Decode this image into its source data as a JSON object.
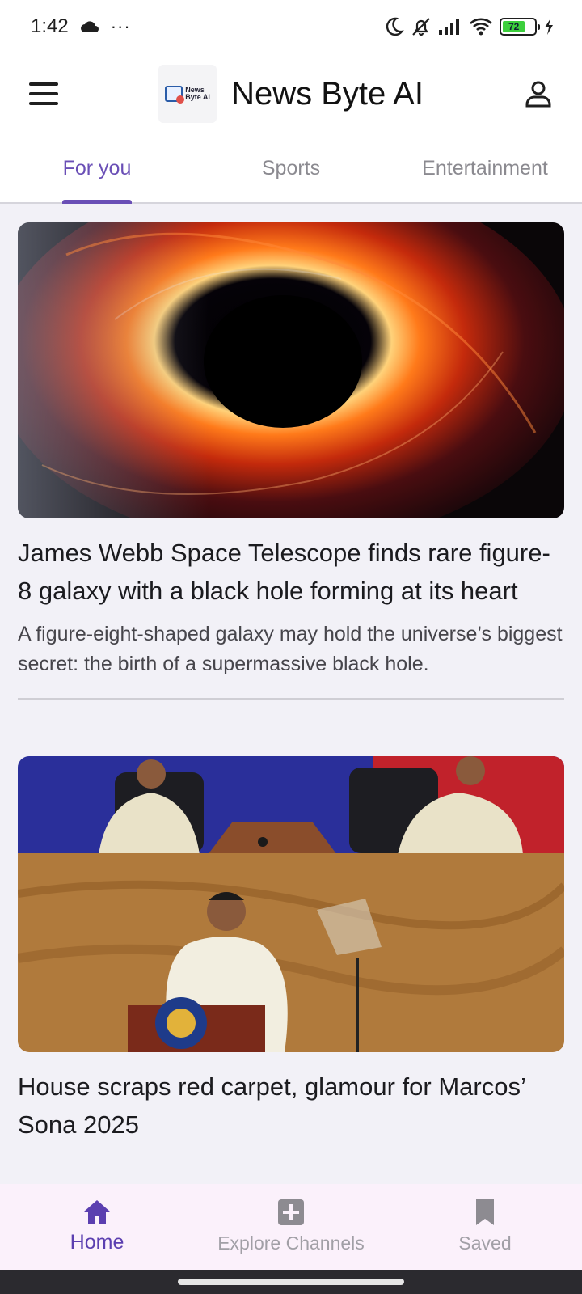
{
  "status_bar": {
    "time": "1:42",
    "more": "···",
    "battery_level": "72",
    "battery_fraction": 0.72
  },
  "app_bar": {
    "logo_text_line1": "News",
    "logo_text_line2": "Byte AI",
    "title": "News Byte AI"
  },
  "tabs": [
    {
      "label": "For you",
      "active": true
    },
    {
      "label": "Sports",
      "active": false
    },
    {
      "label": "Entertainment",
      "active": false
    }
  ],
  "articles": [
    {
      "image_alt": "galaxy-black-hole-image",
      "title": "James Webb Space Telescope finds rare figure-8 galaxy with a black hole forming at its heart",
      "summary": "A figure-eight-shaped galaxy may hold the universe’s biggest secret: the birth of a supermassive black hole."
    },
    {
      "image_alt": "speech-at-podium-image",
      "title": "House scraps red carpet, glamour for Marcos’ Sona 2025",
      "summary": ""
    }
  ],
  "bottom_nav": [
    {
      "label": "Home",
      "icon": "home-icon",
      "active": true
    },
    {
      "label": "Explore Channels",
      "icon": "plus-square-icon",
      "active": false
    },
    {
      "label": "Saved",
      "icon": "bookmark-icon",
      "active": false
    }
  ],
  "colors": {
    "accent": "#6a4fb6",
    "nav_active": "#5b3fb0",
    "inactive": "#a19fa6"
  }
}
